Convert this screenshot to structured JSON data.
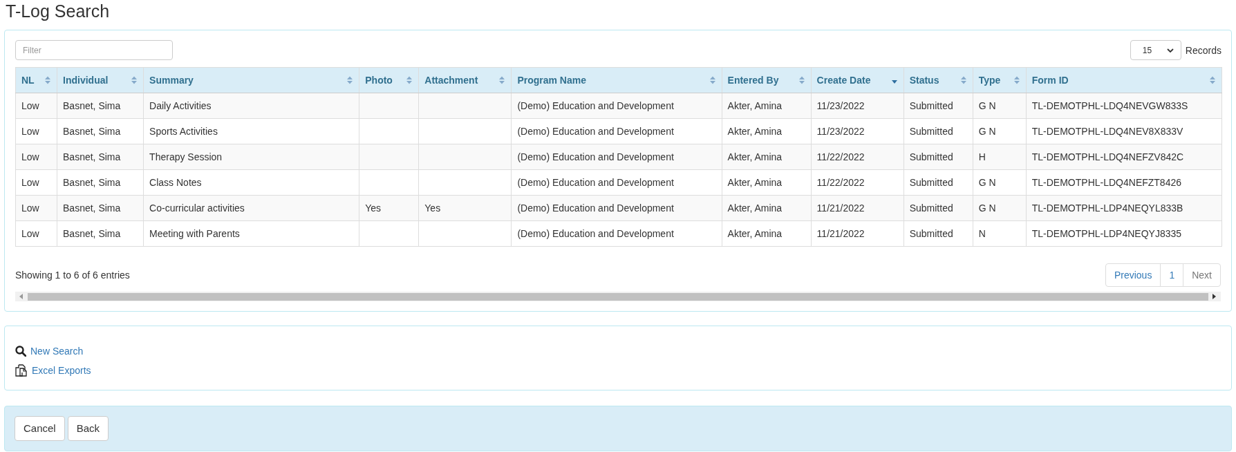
{
  "page_title": "T-Log Search",
  "filter": {
    "placeholder": "Filter"
  },
  "records": {
    "value": "15",
    "label": "Records"
  },
  "table": {
    "columns": [
      {
        "label": "NL",
        "sorted": false
      },
      {
        "label": "Individual",
        "sorted": false
      },
      {
        "label": "Summary",
        "sorted": false
      },
      {
        "label": "Photo",
        "sorted": false
      },
      {
        "label": "Attachment",
        "sorted": false
      },
      {
        "label": "Program Name",
        "sorted": false
      },
      {
        "label": "Entered By",
        "sorted": false
      },
      {
        "label": "Create Date",
        "sorted": true
      },
      {
        "label": "Status",
        "sorted": false
      },
      {
        "label": "Type",
        "sorted": false
      },
      {
        "label": "Form ID",
        "sorted": false
      }
    ],
    "rows": [
      [
        "Low",
        "Basnet, Sima",
        "Daily Activities",
        "",
        "",
        "(Demo) Education and Development",
        "Akter, Amina",
        "11/23/2022",
        "Submitted",
        "G N",
        "TL-DEMOTPHL-LDQ4NEVGW833S"
      ],
      [
        "Low",
        "Basnet, Sima",
        "Sports Activities",
        "",
        "",
        "(Demo) Education and Development",
        "Akter, Amina",
        "11/23/2022",
        "Submitted",
        "G N",
        "TL-DEMOTPHL-LDQ4NEV8X833V"
      ],
      [
        "Low",
        "Basnet, Sima",
        "Therapy Session",
        "",
        "",
        "(Demo) Education and Development",
        "Akter, Amina",
        "11/22/2022",
        "Submitted",
        "H",
        "TL-DEMOTPHL-LDQ4NEFZV842C"
      ],
      [
        "Low",
        "Basnet, Sima",
        "Class Notes",
        "",
        "",
        "(Demo) Education and Development",
        "Akter, Amina",
        "11/22/2022",
        "Submitted",
        "G N",
        "TL-DEMOTPHL-LDQ4NEFZT8426"
      ],
      [
        "Low",
        "Basnet, Sima",
        "Co-curricular activities",
        "Yes",
        "Yes",
        "(Demo) Education and Development",
        "Akter, Amina",
        "11/21/2022",
        "Submitted",
        "G N",
        "TL-DEMOTPHL-LDP4NEQYL833B"
      ],
      [
        "Low",
        "Basnet, Sima",
        "Meeting with Parents",
        "",
        "",
        "(Demo) Education and Development",
        "Akter, Amina",
        "11/21/2022",
        "Submitted",
        "N",
        "TL-DEMOTPHL-LDP4NEQYJ8335"
      ]
    ]
  },
  "info": "Showing 1 to 6 of 6 entries",
  "pagination": [
    {
      "label": "Previous",
      "disabled": false
    },
    {
      "label": "1",
      "disabled": false
    },
    {
      "label": "Next",
      "disabled": true
    }
  ],
  "links": [
    {
      "kind": "search",
      "label": "New Search"
    },
    {
      "kind": "export",
      "label": "Excel Exports"
    }
  ],
  "buttons": [
    "Cancel",
    "Back"
  ]
}
